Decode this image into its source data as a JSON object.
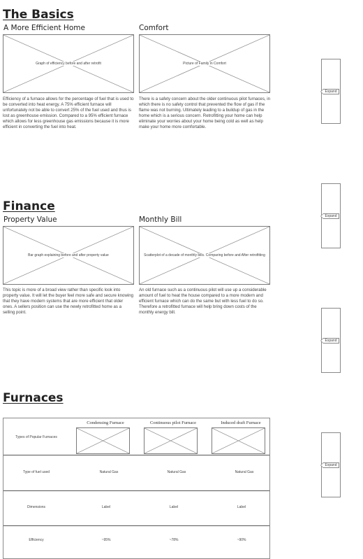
{
  "basics": {
    "title": "The Basics",
    "left": {
      "heading": "A More Efficient Home",
      "image_caption": "Graph of efficiency before and after retrofit",
      "text": "Efficiency of a furnace allows for the percentage of fuel that is used to be converted into heat energy. A 75% efficient furnace will unfortunately not be able to convert 25% of the fuel used and thus is lost as greenhouse emission. Compared to a 95% efficient furnace which allows for less greenhouse gas emissions because it is more efficient in converting the fuel into heat."
    },
    "right": {
      "heading": "Comfort",
      "image_caption": "Picture of Family in Comfort",
      "text": "There is a safety concern about the older continuous pilot furnaces, in which there is no safety control that prevented the flow of gas if the flame was not burning. Ultimately leading to a buildup of gas in the home which is a serious concern. Retrofitting your home can help eliminate your worries about your home being cold as well as help make your home more comfortable."
    }
  },
  "finance": {
    "title": "Finance",
    "left": {
      "heading": "Property Value",
      "image_caption": "Bar graph explaining before and after property value",
      "text": "This topic is more of a broad view rather than specific look into property value. It will let the buyer feel more safe and secure knowing that they have modern systems that are more efficient that older ones. A sellers position can use the newly retrofitted home as a selling point."
    },
    "right": {
      "heading": "Monthly Bill",
      "image_caption": "Scatterplot of a decade of monthly bills. Comparing before and After retrofitting",
      "text": "An old furnace such as a continuous pilot will use up a considerable amount of fuel to heat the house compared to a more modern and efficient furnace which can do the same but with less fuel to do so. Therefore a retrofitted furnace will help bring down costs of the monthly energy bill."
    }
  },
  "furnaces": {
    "title": "Furnaces",
    "columns": [
      "Condensing Furnace",
      "Continuous pilot Furnace",
      "Induced draft Furnace"
    ],
    "rows": [
      {
        "label": "Types of Popular Furnaces",
        "values": [
          "",
          "",
          ""
        ]
      },
      {
        "label": "Type of fuel used",
        "values": [
          "Natural Gas",
          "Natural Gas",
          "Natural Gas"
        ]
      },
      {
        "label": "Dimensions",
        "values": [
          "Label",
          "Label",
          "Label"
        ]
      },
      {
        "label": "Efficiency",
        "values": [
          "~95%",
          "~78%",
          "~90%"
        ]
      }
    ]
  },
  "sidebar": {
    "expand_label": "Expand"
  }
}
